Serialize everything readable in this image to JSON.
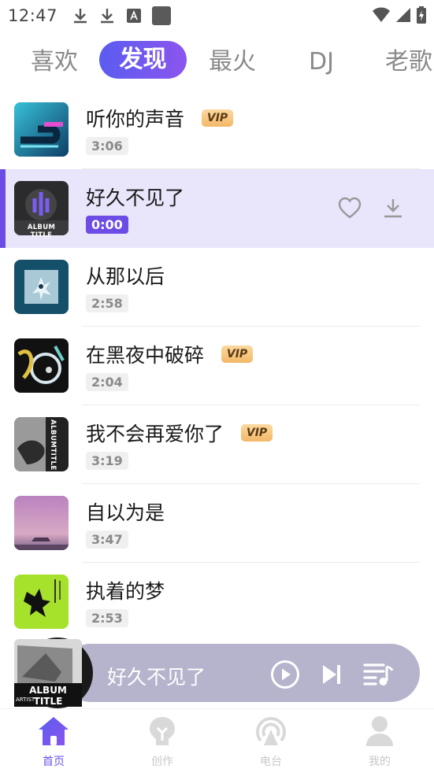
{
  "status_bar": {
    "time": "12:47"
  },
  "tabs": [
    {
      "label": "喜欢",
      "active": false
    },
    {
      "label": "发现",
      "active": true
    },
    {
      "label": "最火",
      "active": false
    },
    {
      "label": "DJ",
      "active": false
    },
    {
      "label": "老歌",
      "active": false
    }
  ],
  "songs": [
    {
      "title": "听你的声音",
      "duration": "3:06",
      "vip": "VIP",
      "cover": "teal-abstract-cover"
    },
    {
      "title": "好久不见了",
      "duration": "0:00",
      "vip": "",
      "playing": true,
      "cover": "album-title-purple-cover",
      "cover_text": "ALBUM TITLE"
    },
    {
      "title": "从那以后",
      "duration": "2:58",
      "vip": "",
      "cover": "blue-broken-glass-cover"
    },
    {
      "title": "在黑夜中破碎",
      "duration": "2:04",
      "vip": "VIP",
      "cover": "iridescent-dark-cover"
    },
    {
      "title": "我不会再爱你了",
      "duration": "3:19",
      "vip": "VIP",
      "cover": "bw-albumtitle-cover",
      "cover_text": "ALBUMTITLE"
    },
    {
      "title": "自以为是",
      "duration": "3:47",
      "vip": "",
      "cover": "purple-sunset-car-cover"
    },
    {
      "title": "执着的梦",
      "duration": "2:53",
      "vip": "",
      "cover": "lime-green-cover"
    }
  ],
  "player": {
    "title": "好久不见了",
    "cover_text": "ALBUM TITLE",
    "cover_subtext": "ARTIST",
    "pill_color": "#b5b4cc"
  },
  "bottom_nav": [
    {
      "label": "首页",
      "icon": "home-icon",
      "active": true
    },
    {
      "label": "创作",
      "icon": "bulb-icon",
      "active": false
    },
    {
      "label": "电台",
      "icon": "radio-icon",
      "active": false
    },
    {
      "label": "我的",
      "icon": "user-icon",
      "active": false
    }
  ],
  "colors": {
    "accent": "#6d4ce6",
    "tab_gradient_start": "#5b5cf0",
    "tab_gradient_end": "#8b55ee",
    "playing_row_bg": "#e9e5fb",
    "nav_active": "#6a55ea"
  }
}
